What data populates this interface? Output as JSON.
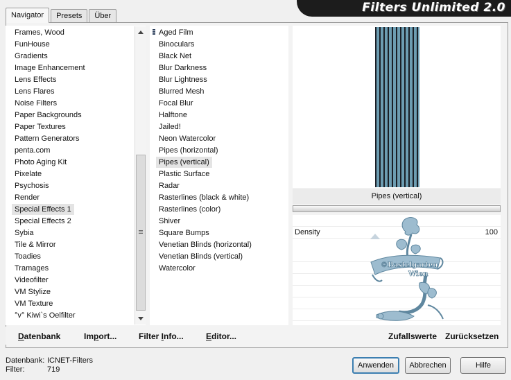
{
  "tabs": [
    "Navigator",
    "Presets",
    "Über"
  ],
  "title": "Filters Unlimited 2.0",
  "categories": [
    "Frames, Wood",
    "FunHouse",
    "Gradients",
    "Image Enhancement",
    "Lens Effects",
    "Lens Flares",
    "Noise Filters",
    "Paper Backgrounds",
    "Paper Textures",
    "Pattern Generators",
    "penta.com",
    "Photo Aging Kit",
    "Pixelate",
    "Psychosis",
    "Render",
    "Special Effects 1",
    "Special Effects 2",
    "Sybia",
    "Tile & Mirror",
    "Toadies",
    "Tramages",
    "Videofilter",
    "VM Stylize",
    "VM Texture",
    "°v° Kiwi`s Oelfilter"
  ],
  "selected_category": "Special Effects 1",
  "filters": [
    "Aged Film",
    "Binoculars",
    "Black Net",
    "Blur Darkness",
    "Blur Lightness",
    "Blurred Mesh",
    "Focal Blur",
    "Halftone",
    "Jailed!",
    "Neon Watercolor",
    "Pipes (horizontal)",
    "Pipes (vertical)",
    "Plastic Surface",
    "Radar",
    "Rasterlines (black & white)",
    "Rasterlines (color)",
    "Shiver",
    "Square Bumps",
    "Venetian Blinds (horizontal)",
    "Venetian Blinds (vertical)",
    "Watercolor"
  ],
  "selected_filter": "Pipes (vertical)",
  "preview_label": "Pipes (vertical)",
  "parameter": {
    "name": "Density",
    "value": "100"
  },
  "watermark": {
    "line1": "©Bastelgarten",
    "line2": "Wien"
  },
  "toolbar": {
    "datenbank": {
      "u": "D",
      "rest": "atenbank"
    },
    "import": {
      "pre": "Im",
      "u": "p",
      "rest": "ort..."
    },
    "filterinfo": {
      "pre": "Filter ",
      "u": "I",
      "rest": "nfo..."
    },
    "editor": {
      "u": "E",
      "rest": "ditor..."
    },
    "random": "Zufallswerte",
    "reset": "Zurücksetzen"
  },
  "footer": {
    "db_label": "Datenbank:",
    "db_value": "ICNET-Filters",
    "filter_label": "Filter:",
    "filter_value": "719"
  },
  "buttons": {
    "apply": "Anwenden",
    "cancel": "Abbrechen",
    "help": "Hilfe"
  },
  "colors": {
    "pipe_dark": "#1a1f26",
    "pipe_light": "#6d9db2",
    "watermark": "#7aa2bb",
    "banner": "#1c1c1c"
  }
}
